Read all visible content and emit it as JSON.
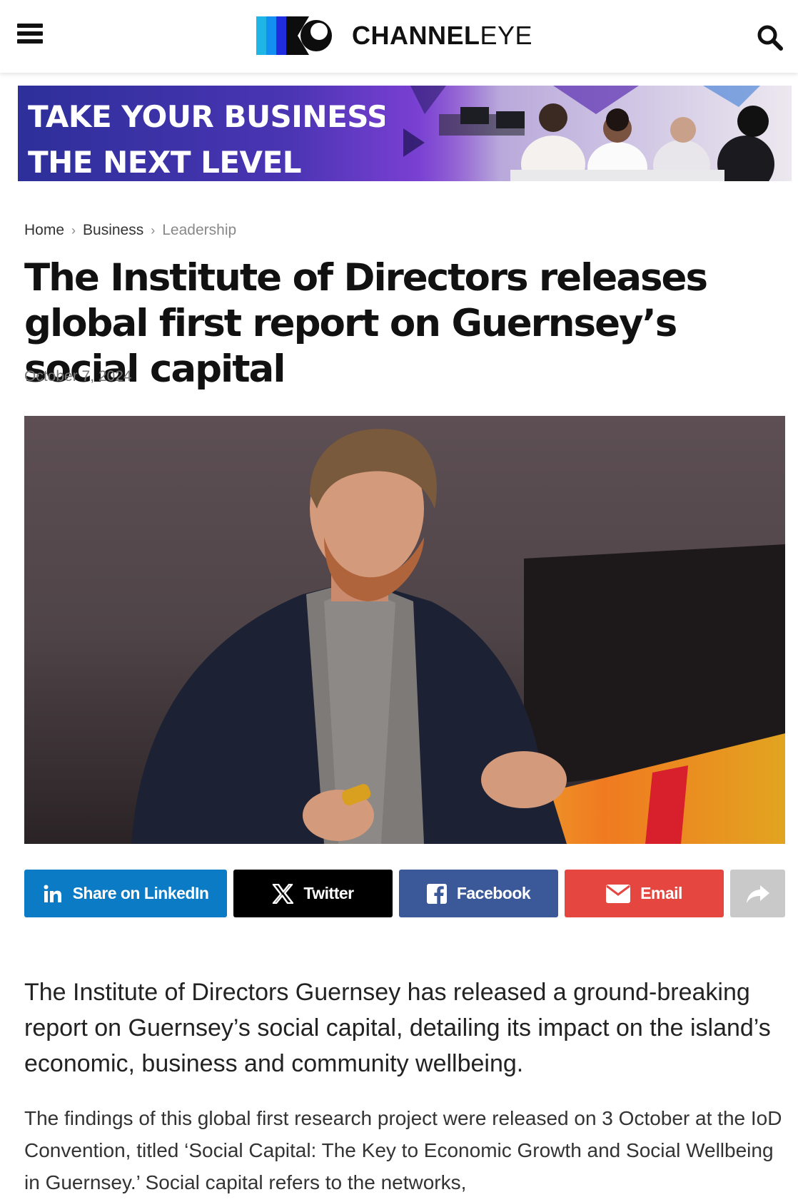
{
  "header": {
    "logo_text_bold": "CHANNEL",
    "logo_text_light": "EYE",
    "menu_icon": "hamburger-menu-icon",
    "search_icon": "search-icon"
  },
  "banner": {
    "line1": "TAKE YOUR BUSINESS TO",
    "line2": "THE NEXT LEVEL"
  },
  "breadcrumb": {
    "items": [
      "Home",
      "Business",
      "Leadership"
    ],
    "separator": "›"
  },
  "article": {
    "title": "The Institute of Directors releases global first report on Guernsey’s social capital",
    "date": "October 7, 2024",
    "lead": "The Institute of Directors Guernsey has released a ground-breaking report on Guernsey’s social capital, detailing its impact on the island’s economic, business and community wellbeing.",
    "paragraph1": "The findings of this global first research project were released on 3 October at the IoD Convention, titled ‘Social Capital: The Key to Economic Growth and Social Wellbeing in Guernsey.’  Social capital refers to the networks,"
  },
  "share": {
    "linkedin": "Share on LinkedIn",
    "twitter": "Twitter",
    "facebook": "Facebook",
    "email": "Email"
  },
  "colors": {
    "linkedin": "#0a7bc4",
    "twitter": "#000000",
    "facebook": "#3b5998",
    "email": "#e5463f",
    "more": "#c9c9c9",
    "banner_purple": "#4a35b3"
  }
}
